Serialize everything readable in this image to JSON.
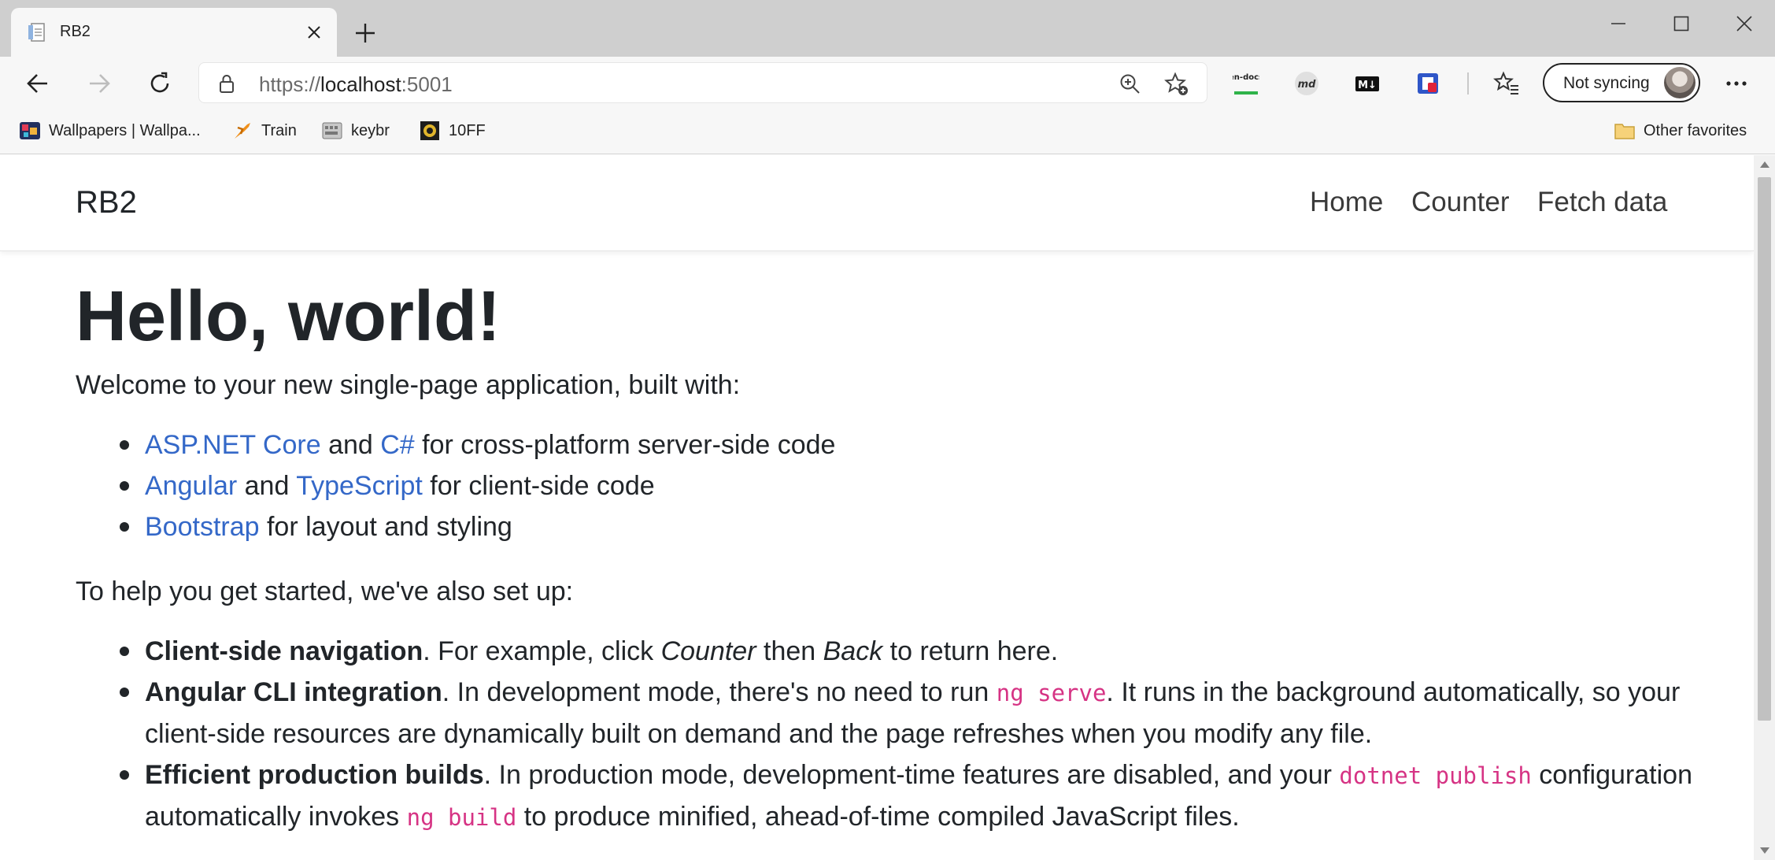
{
  "browser": {
    "tab": {
      "title": "RB2"
    },
    "address": {
      "scheme": "https://",
      "host": "localhost",
      "port": ":5001"
    },
    "sync_label": "Not syncing",
    "favorites": [
      {
        "label": "Wallpapers | Wallpa..."
      },
      {
        "label": "Train"
      },
      {
        "label": "keybr"
      },
      {
        "label": "10FF"
      }
    ],
    "other_favorites": "Other favorites",
    "extensions": [
      {
        "label": "en-docs"
      },
      {
        "label": "md"
      },
      {
        "label": "M↓"
      }
    ]
  },
  "app": {
    "brand": "RB2",
    "nav": [
      {
        "label": "Home"
      },
      {
        "label": "Counter"
      },
      {
        "label": "Fetch data"
      }
    ]
  },
  "page": {
    "heading": "Hello, world!",
    "intro": "Welcome to your new single-page application, built with:",
    "built_with": [
      {
        "link1": "ASP.NET Core",
        "mid": " and ",
        "link2": "C#",
        "rest": " for cross-platform server-side code"
      },
      {
        "link1": "Angular",
        "mid": " and ",
        "link2": "TypeScript",
        "rest": " for client-side code"
      },
      {
        "link1": "Bootstrap",
        "rest": " for layout and styling"
      }
    ],
    "setup_intro": "To help you get started, we've also set up:",
    "setup": [
      {
        "title": "Client-side navigation",
        "text1": ". For example, click ",
        "em1": "Counter",
        "text2": " then ",
        "em2": "Back",
        "text3": " to return here."
      },
      {
        "title": "Angular CLI integration",
        "text1": ". In development mode, there's no need to run ",
        "code1": "ng serve",
        "text2": ". It runs in the background automatically, so your client-side resources are dynamically built on demand and the page refreshes when you modify any file."
      },
      {
        "title": "Efficient production builds",
        "text1": ". In production mode, development-time features are disabled, and your ",
        "code1": "dotnet publish",
        "text2": " configuration automatically invokes ",
        "code2": "ng build",
        "text3": " to produce minified, ahead-of-time compiled JavaScript files."
      }
    ]
  }
}
